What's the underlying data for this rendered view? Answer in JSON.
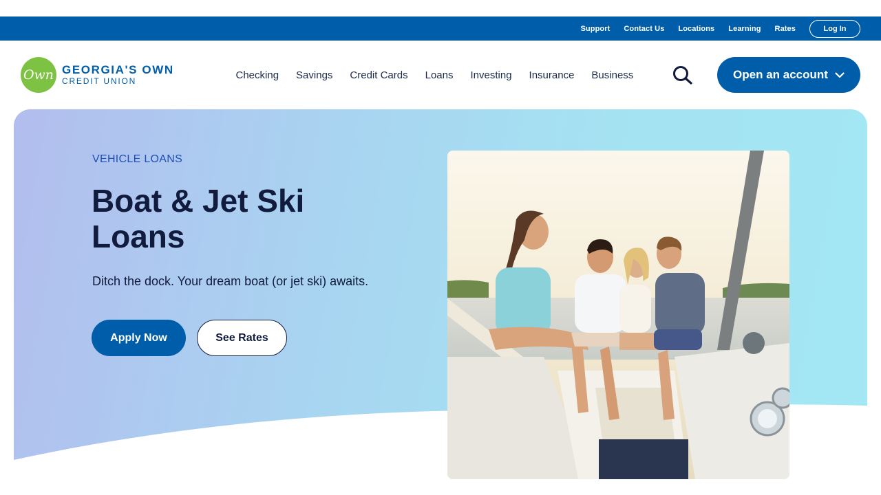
{
  "utility_nav": {
    "links": [
      "Support",
      "Contact Us",
      "Locations",
      "Learning",
      "Rates"
    ],
    "login_label": "Log In"
  },
  "logo": {
    "mark": "Own",
    "line1": "GEORGIA'S OWN",
    "line2": "CREDIT UNION"
  },
  "main_nav": {
    "items": [
      "Checking",
      "Savings",
      "Credit Cards",
      "Loans",
      "Investing",
      "Insurance",
      "Business"
    ],
    "search_icon": "search-icon",
    "cta_label": "Open an account",
    "cta_icon": "chevron-down-icon"
  },
  "hero": {
    "eyebrow": "VEHICLE LOANS",
    "title": "Boat & Jet Ski Loans",
    "subtitle": "Ditch the dock. Your dream boat (or jet ski) awaits.",
    "primary_button": "Apply Now",
    "secondary_button": "See Rates"
  },
  "colors": {
    "brand_blue": "#005da9",
    "brand_green": "#7dc242",
    "heading_navy": "#111b3d",
    "eyebrow_blue": "#1f4fb2"
  }
}
